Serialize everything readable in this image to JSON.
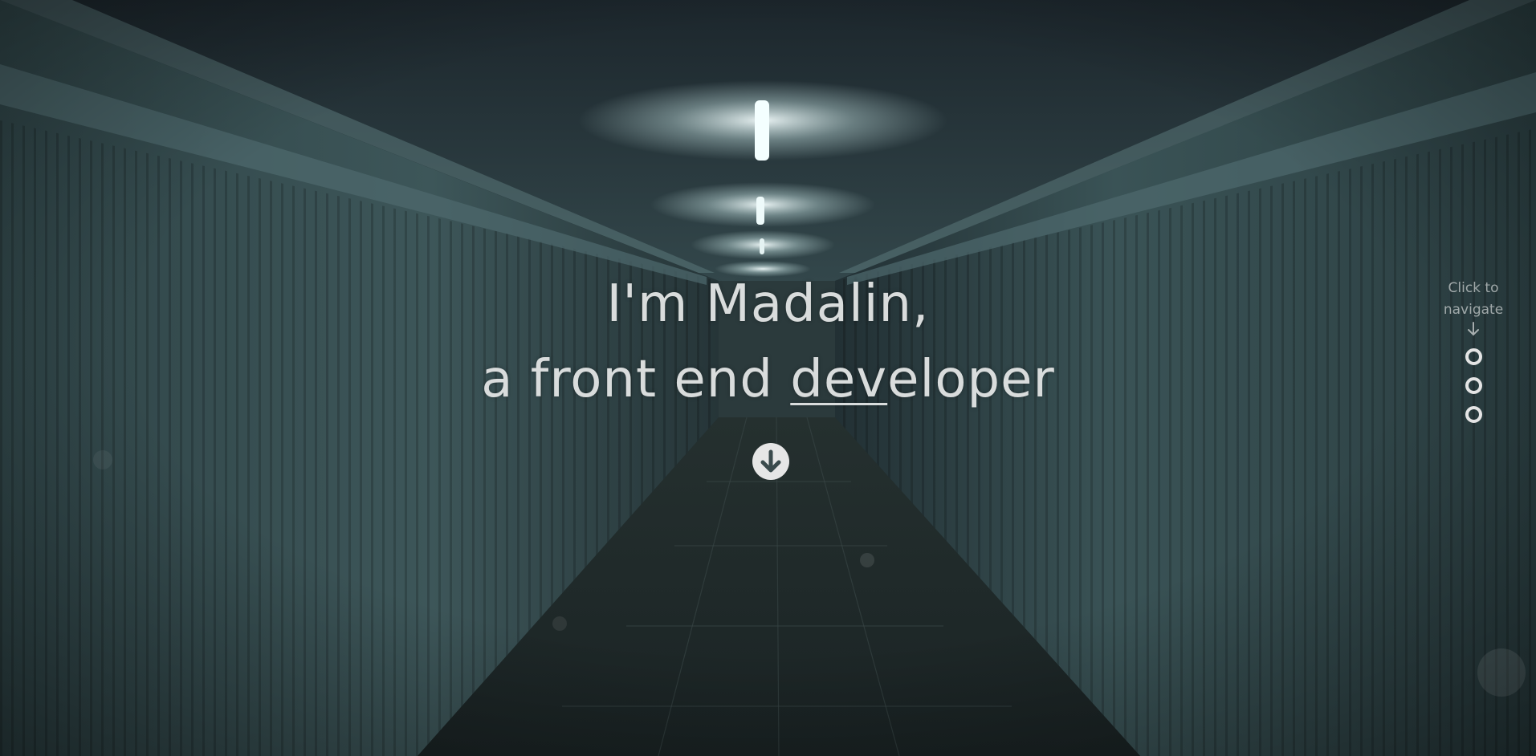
{
  "hero": {
    "greeting": "I'm Madalin,",
    "role_prefix": "a front end ",
    "role_underlined": "dev",
    "role_suffix": "eloper"
  },
  "side_nav": {
    "hint_line1": "Click to",
    "hint_line2": "navigate",
    "dots": [
      "section-1",
      "section-2",
      "section-3"
    ]
  },
  "icons": {
    "scroll_down": "arrow-circle-down-icon",
    "nav_hint_arrow": "arrow-down-icon"
  },
  "colors": {
    "background": "#1d2b2e",
    "text": "#d9dcdc",
    "button": "#e6e6e6"
  }
}
